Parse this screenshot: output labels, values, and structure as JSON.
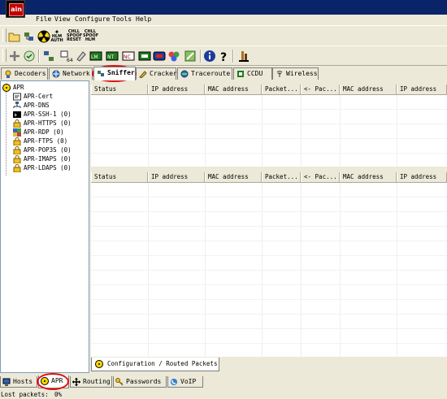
{
  "app": {
    "logo_text": "ain",
    "accent": "#0a246a",
    "highlight": "#e01010"
  },
  "menu": [
    "File",
    "View",
    "Configure",
    "Tools",
    "Help"
  ],
  "toolbar1": {
    "buttons": [
      {
        "icon": "open-folder-icon"
      },
      {
        "icon": "network-sniffer-icon"
      },
      {
        "icon": "radiation-icon"
      }
    ],
    "text_buttons": [
      {
        "icon": "hlm-auth-icon",
        "line1": "HLM",
        "line2": "AUTH"
      },
      {
        "icon": "chll-spoof-reset-icon",
        "line1": "CHLL SPOOF",
        "line2": "RESET"
      },
      {
        "icon": "chll-spoof-hlm-icon",
        "line1": "CHLL SPOOF",
        "line2": "HLM"
      }
    ]
  },
  "toolbar2": {
    "buttons": [
      "plus-icon",
      "filter-icon",
      "network-tools-icon",
      "base64-icon",
      "certificate-icon",
      "calc-icon",
      "rsa-icon",
      "wireless-icon",
      "terminal-icon",
      "id-card-icon",
      "color-wheel-icon",
      "password-icon",
      "info-icon",
      "help-icon",
      "cain-icon"
    ]
  },
  "main_tabs": [
    {
      "label": "Decoders",
      "icon": "decoders-icon"
    },
    {
      "label": "Network",
      "icon": "network-icon"
    },
    {
      "label": "Sniffer",
      "icon": "sniffer-icon",
      "active": true
    },
    {
      "label": "Cracker",
      "icon": "cracker-icon"
    },
    {
      "label": "Traceroute",
      "icon": "traceroute-icon"
    },
    {
      "label": "CCDU",
      "icon": "ccdu-icon"
    },
    {
      "label": "Wireless",
      "icon": "wireless-icon"
    }
  ],
  "tree": {
    "root": "APR",
    "children": [
      {
        "label": "APR-Cert",
        "icon": "certificate-icon"
      },
      {
        "label": "APR-DNS",
        "icon": "dns-icon"
      },
      {
        "label": "APR-SSH-1  (0)",
        "icon": "terminal-icon"
      },
      {
        "label": "APR-HTTPS  (0)",
        "icon": "lock-icon"
      },
      {
        "label": "APR-RDP  (0)",
        "icon": "rdp-icon"
      },
      {
        "label": "APR-FTPS  (0)",
        "icon": "lock-icon"
      },
      {
        "label": "APR-POP3S  (0)",
        "icon": "lock-icon"
      },
      {
        "label": "APR-IMAPS  (0)",
        "icon": "lock-icon"
      },
      {
        "label": "APR-LDAPS  (0)",
        "icon": "lock-icon"
      }
    ]
  },
  "table_top": {
    "columns": [
      "Status",
      "IP address",
      "MAC address",
      "Packet...",
      "<- Pac...",
      "MAC address",
      "IP address"
    ]
  },
  "table_bottom": {
    "columns": [
      "Status",
      "IP address",
      "MAC address",
      "Packet...",
      "<- Pac...",
      "MAC address",
      "IP address"
    ]
  },
  "config_tab": {
    "label": "Configuration / Routed Packets"
  },
  "bottom_tabs": [
    {
      "label": "Hosts",
      "icon": "hosts-icon"
    },
    {
      "label": "APR",
      "icon": "apr-icon",
      "active": true
    },
    {
      "label": "Routing",
      "icon": "routing-icon"
    },
    {
      "label": "Passwords",
      "icon": "passwords-icon"
    },
    {
      "label": "VoIP",
      "icon": "voip-icon"
    }
  ],
  "status": {
    "label": "Lost packets:",
    "value": "0%"
  }
}
